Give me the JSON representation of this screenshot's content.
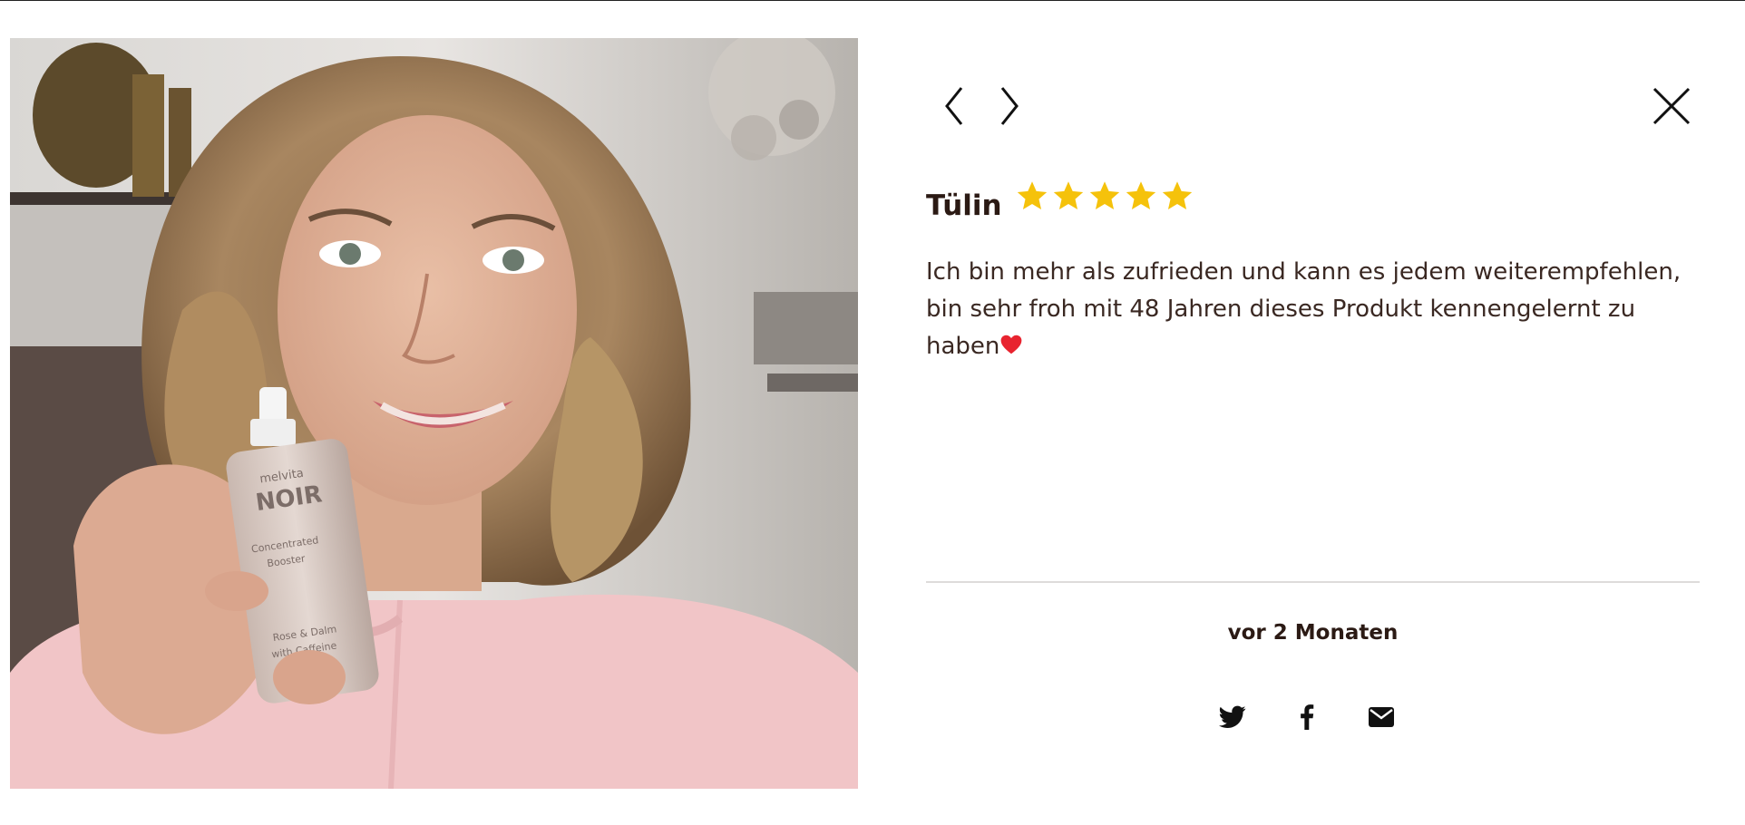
{
  "review": {
    "reviewer_name": "Tülin",
    "rating": 5,
    "rating_max": 5,
    "text": "Ich bin mehr als zufrieden und kann es jedem weiterempfehlen, bin sehr froh mit 48 Jahren dieses Produkt kennengelernt zu haben",
    "text_emoji": "heart",
    "date": "vor 2 Monaten",
    "photo": {
      "bottle_lines": [
        "melvita",
        "NOIR",
        "Concentrated",
        "Booster",
        "Rose & Dalm",
        "with Caffeine"
      ]
    }
  },
  "navigation": {
    "prev_icon": "chevron-left-icon",
    "next_icon": "chevron-right-icon",
    "close_icon": "close-icon"
  },
  "share": {
    "icons": [
      "twitter-icon",
      "facebook-icon",
      "mail-icon"
    ]
  },
  "colors": {
    "star": "#f5c20b",
    "text": "#2f1e17",
    "divider": "#dedbda",
    "sweater": "#f1c5c7"
  }
}
